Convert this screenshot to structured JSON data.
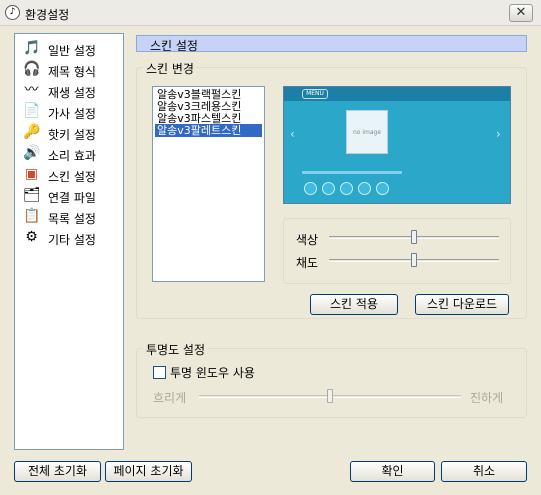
{
  "window": {
    "title": "환경설정",
    "close_glyph": "✕"
  },
  "nav": {
    "items": [
      {
        "label": "일반 설정",
        "icon": "general-icon",
        "glyph": "🎵"
      },
      {
        "label": "제목 형식",
        "icon": "title-format-icon",
        "glyph": "🎧"
      },
      {
        "label": "재생 설정",
        "icon": "playback-icon",
        "glyph": "〰"
      },
      {
        "label": "가사 설정",
        "icon": "lyrics-icon",
        "glyph": "📄"
      },
      {
        "label": "핫키 설정",
        "icon": "hotkey-icon",
        "glyph": "🔑"
      },
      {
        "label": "소리 효과",
        "icon": "sound-effect-icon",
        "glyph": "🔊"
      },
      {
        "label": "스킨 설정",
        "icon": "skin-icon",
        "glyph": "▣"
      },
      {
        "label": "연결 파일",
        "icon": "file-association-icon",
        "glyph": "🗂"
      },
      {
        "label": "목록 설정",
        "icon": "playlist-icon",
        "glyph": "📋"
      },
      {
        "label": "기타 설정",
        "icon": "etc-icon",
        "glyph": "⚙"
      }
    ],
    "selected_index": 6
  },
  "section": {
    "title": "스킨 설정"
  },
  "skin_change": {
    "group_title": "스킨 변경",
    "skins": [
      "알송v3블랙펄스킨",
      "알송v3크레용스킨",
      "알송v3파스텔스킨",
      "알송v3팔레트스킨"
    ],
    "selected_index": 3,
    "preview": {
      "menu_label": "MENU",
      "no_image_label": "no image"
    },
    "color_label": "색상",
    "saturation_label": "채도",
    "color_level": 0.5,
    "saturation_level": 0.5,
    "apply_button": "스킨 적용",
    "download_button": "스킨 다운로드"
  },
  "transparency": {
    "group_title": "투명도 설정",
    "checkbox_label": "투명 윈도우 사용",
    "checked": false,
    "left_label": "흐리게",
    "right_label": "진하게",
    "level": 0.5
  },
  "footer": {
    "reset_all": "전체 초기화",
    "reset_page": "페이지 초기화",
    "ok": "확인",
    "cancel": "취소"
  }
}
